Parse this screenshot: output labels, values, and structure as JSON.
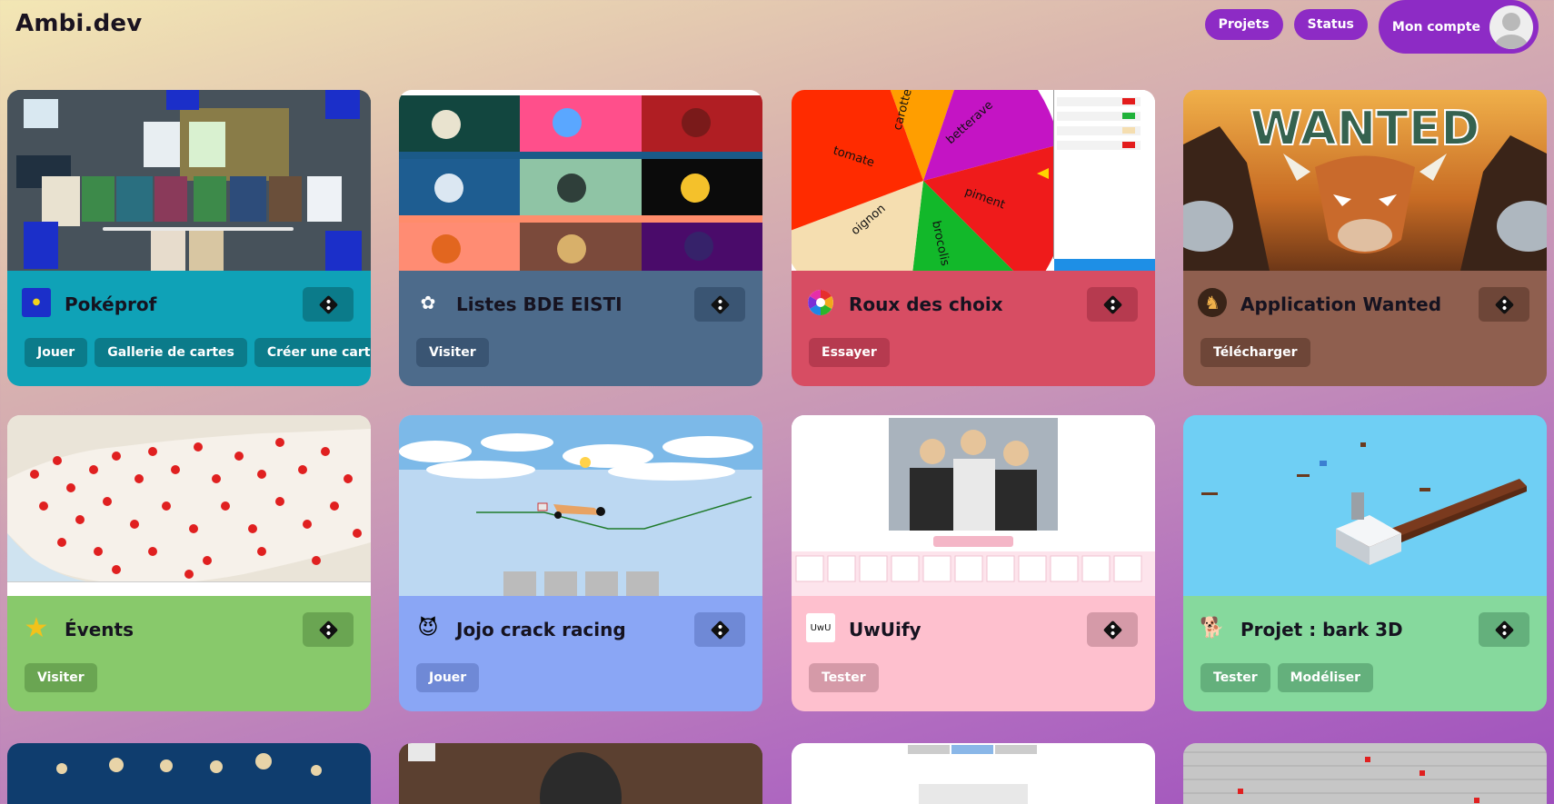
{
  "header": {
    "brand": "Ambi.dev",
    "nav": {
      "projects": "Projets",
      "status": "Status",
      "account": "Mon compte"
    }
  },
  "cards": [
    {
      "title": "Poképrof",
      "logo_icon": "pokeprof-logo-icon",
      "color": "#0fa2b7",
      "button_color": "#0b7b8a",
      "buttons": [
        "Jouer",
        "Gallerie de cartes",
        "Créer une carte"
      ]
    },
    {
      "title": "Listes BDE EISTI",
      "logo_icon": "bde-logo-icon",
      "color": "#4d6b8b",
      "button_color": "#3a5573",
      "buttons": [
        "Visiter"
      ]
    },
    {
      "title": "Roux des choix",
      "logo_icon": "color-wheel-icon",
      "color": "#d74d63",
      "button_color": "#b63a4f",
      "buttons": [
        "Essayer"
      ],
      "wheel_labels": [
        "carotte",
        "betterave",
        "tomate",
        "piment",
        "oignon",
        "brocolis"
      ]
    },
    {
      "title": "Application Wanted",
      "logo_icon": "bison-logo-icon",
      "color": "#8f5f4f",
      "button_color": "#6e4638",
      "buttons": [
        "Télécharger"
      ],
      "screenshot_text": "WANTED"
    },
    {
      "title": "Évents",
      "logo_icon": "star-icon",
      "color": "#88c96b",
      "button_color": "#6aa552",
      "buttons": [
        "Visiter"
      ]
    },
    {
      "title": "Jojo crack racing",
      "logo_icon": "jojo-avatar-icon",
      "color": "#8aa6f5",
      "button_color": "#6f89d6",
      "buttons": [
        "Jouer"
      ]
    },
    {
      "title": "UwUify",
      "logo_icon": "uwu-logo-icon",
      "logo_text": "UwU",
      "color": "#fec0ce",
      "button_color": "#d59aa8",
      "buttons": [
        "Tester"
      ]
    },
    {
      "title": "Projet : bark 3D",
      "logo_icon": "dog-icon",
      "color": "#86d99d",
      "button_color": "#64b07c",
      "buttons": [
        "Tester",
        "Modéliser"
      ]
    }
  ]
}
